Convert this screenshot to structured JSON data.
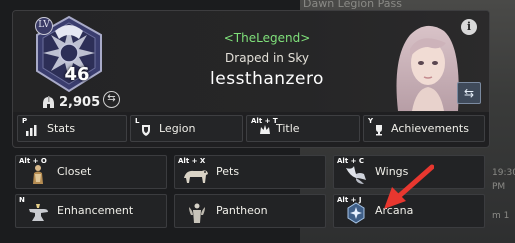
{
  "background": {
    "banner_text": "Dawn Legion Pass",
    "side_texts": [
      "19:30",
      "PM",
      "m 1"
    ]
  },
  "profile": {
    "level_badge": "LV",
    "level": "46",
    "power": "2,905",
    "guild_tag": "<TheLegend>",
    "title": "Draped in Sky",
    "name": "lessthanzero",
    "info_symbol": "i",
    "swap_symbol": "⇆"
  },
  "tabs": [
    {
      "key": "P",
      "label": "Stats",
      "icon": "bar-chart-icon"
    },
    {
      "key": "L",
      "label": "Legion",
      "icon": "legion-shield-icon"
    },
    {
      "key": "Alt + T",
      "label": "Title",
      "icon": "title-crown-icon"
    },
    {
      "key": "Y",
      "label": "Achievements",
      "icon": "trophy-icon"
    }
  ],
  "menu": [
    {
      "key": "Alt + O",
      "label": "Closet",
      "icon": "closet-icon"
    },
    {
      "key": "Alt + X",
      "label": "Pets",
      "icon": "pet-icon"
    },
    {
      "key": "Alt + C",
      "label": "Wings",
      "icon": "wings-icon"
    },
    {
      "key": "N",
      "label": "Enhancement",
      "icon": "anvil-icon"
    },
    {
      "key": "",
      "label": "Pantheon",
      "icon": "statue-icon"
    },
    {
      "key": "Alt + J",
      "label": "Arcana",
      "icon": "arcana-icon"
    }
  ],
  "colors": {
    "guild_tag": "#7fe07a",
    "annotation_arrow": "#e8372f"
  }
}
